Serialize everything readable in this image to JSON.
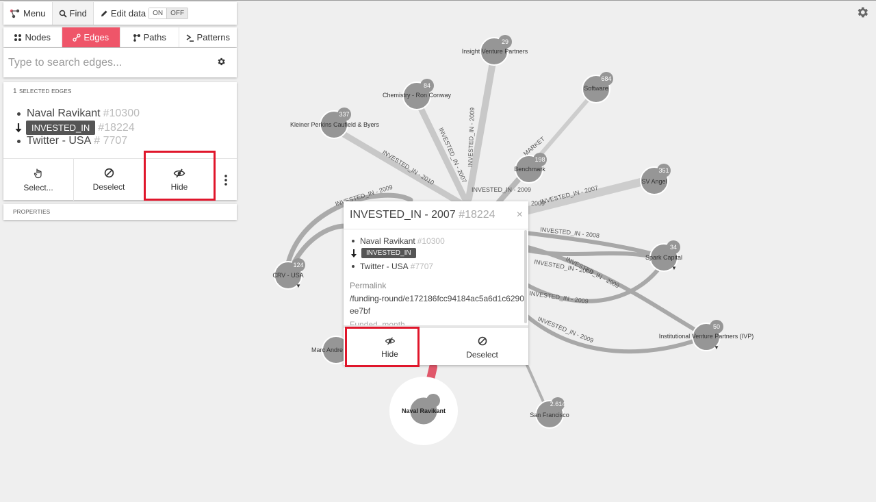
{
  "toolbar": {
    "menu_label": "Menu",
    "find_label": "Find",
    "edit_label": "Edit data",
    "toggle_on": "ON",
    "toggle_off": "OFF"
  },
  "tabs": [
    {
      "label": "Nodes",
      "icon": "nodes-icon"
    },
    {
      "label": "Edges",
      "icon": "edge-icon",
      "active": true
    },
    {
      "label": "Paths",
      "icon": "path-icon"
    },
    {
      "label": "Patterns",
      "icon": "terminal-icon"
    }
  ],
  "search": {
    "placeholder": "Type to search edges..."
  },
  "selection": {
    "count": "1",
    "title": "SELECTED EDGES",
    "source": {
      "label": "Naval Ravikant",
      "id": "#10300"
    },
    "edge": {
      "label": "INVESTED_IN",
      "id": "#18224"
    },
    "target": {
      "label": "Twitter - USA",
      "id": "# 7707"
    },
    "actions": {
      "select": "Select...",
      "deselect": "Deselect",
      "hide": "Hide"
    }
  },
  "properties": {
    "title": "PROPERTIES"
  },
  "popup": {
    "title": "INVESTED_IN - 2007",
    "id": "#18224",
    "close": "×",
    "source": {
      "label": "Naval Ravikant",
      "id": "#10300"
    },
    "edge": {
      "label": "INVESTED_IN"
    },
    "target": {
      "label": "Twitter - USA",
      "id": "#7707"
    },
    "property_label": "Permalink",
    "property_value": "/funding-round/e172186fcc94184ac5a6d1c6290ee7bf",
    "next_property_label": "Funded_month",
    "actions": {
      "hide": "Hide",
      "deselect": "Deselect"
    }
  },
  "graph": {
    "nodes": [
      {
        "label": "Insight Venture Partners",
        "count": "29"
      },
      {
        "label": "Chemistry - Ron Conway",
        "count": "84"
      },
      {
        "label": "Software",
        "count": "684"
      },
      {
        "label": "Kleiner Perkins Caufield & Byers",
        "count": "337"
      },
      {
        "label": "Benchmark",
        "count": "198"
      },
      {
        "label": "SV Angel",
        "count": "351"
      },
      {
        "label": "Spark Capital",
        "count": "34"
      },
      {
        "label": "CRV - USA",
        "count": "124"
      },
      {
        "label": "Institutional Venture Partners (IVP)",
        "count": "50"
      },
      {
        "label": "Marc Andre",
        "count": ""
      },
      {
        "label": "San Francisco",
        "count": "2.614"
      },
      {
        "label": "Naval Ravikant",
        "count": ""
      }
    ],
    "edge_labels": [
      "INVESTED_IN - 2009",
      "INVESTED_IN - 2007",
      "INVESTED_IN - 2010",
      "INVESTED_IN - 2009",
      "MARKET",
      "INVESTED_IN - 2009",
      "INVESTED_IN - 2007",
      "2009",
      "INVESTED_IN - 2008",
      "INVESTED_IN - 2009",
      "INVESTED_IN - 2009",
      "INVESTED_IN - 2009",
      "INVESTED_IN - 2009"
    ]
  }
}
